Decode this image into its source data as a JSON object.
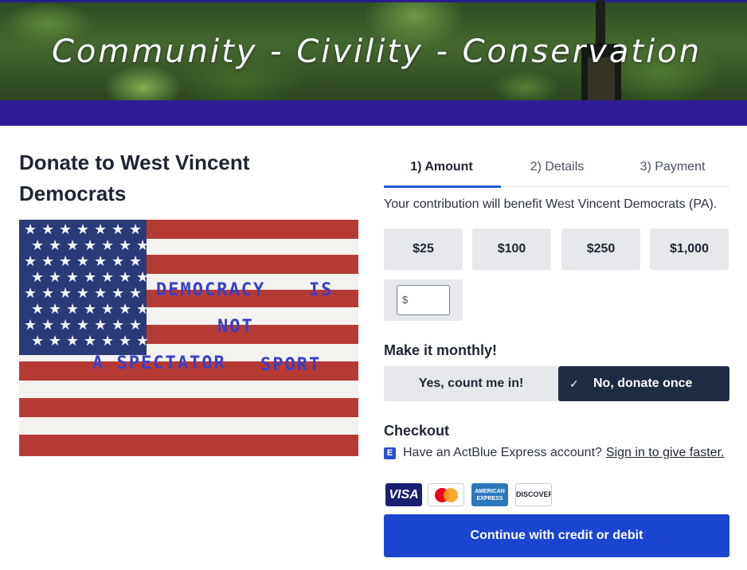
{
  "banner": {
    "tagline": "Community - Civility - Conservation"
  },
  "page": {
    "title": "Donate to West Vincent Democrats"
  },
  "image": {
    "flag_line1_a": "DEMOCRACY",
    "flag_line1_b": "IS",
    "flag_line2": "NOT",
    "flag_line3_a": "A SPECTATOR",
    "flag_line3_b": "SPORT"
  },
  "tabs": [
    {
      "label": "1) Amount",
      "active": true
    },
    {
      "label": "2) Details",
      "active": false
    },
    {
      "label": "3) Payment",
      "active": false
    }
  ],
  "contribution": {
    "benefit_text": "Your contribution will benefit West Vincent Democrats (PA)."
  },
  "amounts": [
    "$25",
    "$100",
    "$250",
    "$1,000"
  ],
  "custom_amount": {
    "prefix": "$",
    "value": ""
  },
  "monthly": {
    "heading": "Make it monthly!",
    "yes_label": "Yes, count me in!",
    "no_label": "No, donate once",
    "selected": "no"
  },
  "checkout": {
    "heading": "Checkout",
    "express_text": "Have an ActBlue Express account?",
    "express_link": "Sign in to give faster.",
    "express_icon": "E"
  },
  "cards": {
    "visa": "VISA",
    "amex": "AMERICAN EXPRESS",
    "discover": "DISCOVER"
  },
  "continue_label": "Continue with credit or debit",
  "colors": {
    "accent": "#1b45d1",
    "banner_strip": "#2e1d96",
    "toggle_selected": "#1f2a44"
  }
}
